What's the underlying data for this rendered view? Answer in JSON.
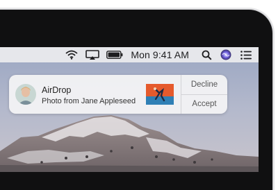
{
  "menubar": {
    "clock": "Mon 9:41 AM",
    "icons": [
      "wifi-icon",
      "airplay-icon",
      "battery-icon",
      "spotlight-search-icon",
      "siri-icon",
      "notification-center-icon"
    ]
  },
  "notification": {
    "app_name": "AirDrop",
    "message": "Photo from Jane Appleseed",
    "decline_label": "Decline",
    "accept_label": "Accept"
  },
  "colors": {
    "bezel": "#101011",
    "menubar": "#ececee",
    "notification_bg": "#f2f2f4",
    "thumbnail_accent": "#e55a2c",
    "siri_accent": "#5a4fd6"
  }
}
